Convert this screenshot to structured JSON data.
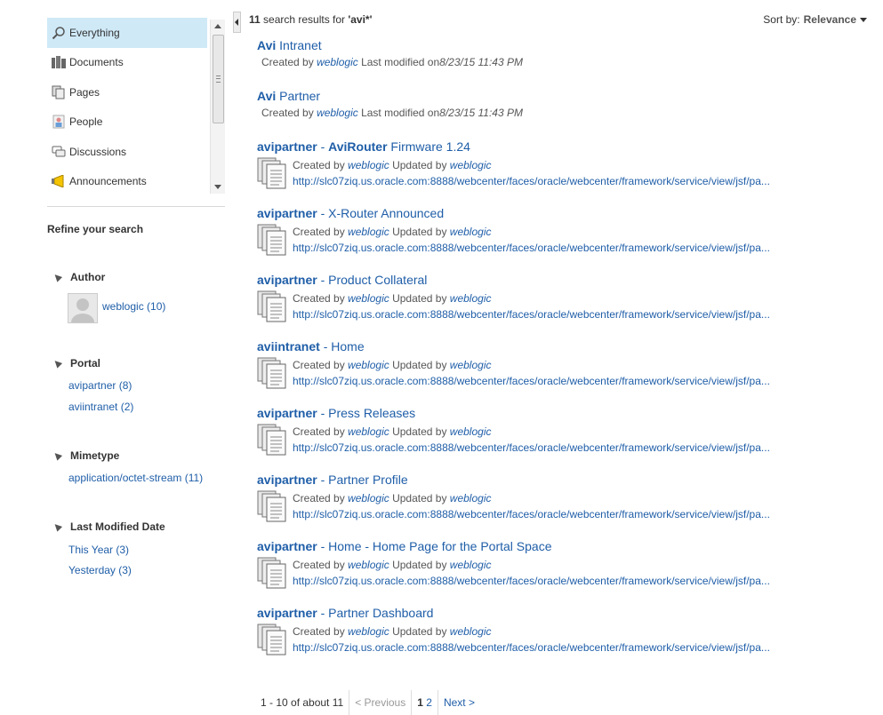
{
  "left": {
    "categories": [
      {
        "label": "Everything",
        "icon": "search-icon",
        "selected": true
      },
      {
        "label": "Documents",
        "icon": "documents-icon"
      },
      {
        "label": "Pages",
        "icon": "pages-icon"
      },
      {
        "label": "People",
        "icon": "people-icon"
      },
      {
        "label": "Discussions",
        "icon": "discussions-icon"
      },
      {
        "label": "Announcements",
        "icon": "announcements-icon"
      }
    ],
    "refine_label": "Refine your search",
    "facets": {
      "author": {
        "title": "Author",
        "items": [
          "weblogic (10)"
        ]
      },
      "portal": {
        "title": "Portal",
        "items": [
          "avipartner (8)",
          "aviintranet (2)"
        ]
      },
      "mimetype": {
        "title": "Mimetype",
        "items": [
          "application/octet-stream (11)"
        ]
      },
      "modified": {
        "title": "Last Modified Date",
        "items": [
          "This Year (3)",
          "Yesterday (3)"
        ]
      }
    }
  },
  "header": {
    "count": "11",
    "text": " search results for ",
    "query": "'avi*'",
    "sort_label": "Sort by:",
    "sort_value": "Relevance"
  },
  "results": [
    {
      "title_bold": "Avi",
      "title_rest": " Intranet",
      "type": "page",
      "created_label": "Created by ",
      "user": "weblogic",
      "mod_label": " Last modified on",
      "date": "8/23/15 11:43 PM"
    },
    {
      "title_bold": "Avi",
      "title_rest": " Partner",
      "type": "page",
      "created_label": "Created by ",
      "user": "weblogic",
      "mod_label": " Last modified on",
      "date": "8/23/15 11:43 PM"
    },
    {
      "title_bold": "avipartner",
      "title_mid": " - ",
      "title_bold2": "AviRouter",
      "title_rest": " Firmware 1.24",
      "type": "doc",
      "created_label": "Created by ",
      "user": "weblogic",
      "upd_label": " Updated by ",
      "user2": "weblogic",
      "url": "http://slc07ziq.us.oracle.com:8888/webcenter/faces/oracle/webcenter/framework/service/view/jsf/pa..."
    },
    {
      "title_bold": "avipartner",
      "title_rest": " - X-Router Announced",
      "type": "doc",
      "created_label": "Created by ",
      "user": "weblogic",
      "upd_label": " Updated by ",
      "user2": "weblogic",
      "url": "http://slc07ziq.us.oracle.com:8888/webcenter/faces/oracle/webcenter/framework/service/view/jsf/pa..."
    },
    {
      "title_bold": "avipartner",
      "title_rest": " - Product Collateral",
      "type": "doc",
      "created_label": "Created by ",
      "user": "weblogic",
      "upd_label": " Updated by ",
      "user2": "weblogic",
      "url": "http://slc07ziq.us.oracle.com:8888/webcenter/faces/oracle/webcenter/framework/service/view/jsf/pa..."
    },
    {
      "title_bold": "aviintranet",
      "title_rest": " - Home",
      "type": "doc",
      "created_label": "Created by ",
      "user": "weblogic",
      "upd_label": " Updated by ",
      "user2": "weblogic",
      "url": "http://slc07ziq.us.oracle.com:8888/webcenter/faces/oracle/webcenter/framework/service/view/jsf/pa..."
    },
    {
      "title_bold": "avipartner",
      "title_rest": " - Press Releases",
      "type": "doc",
      "created_label": "Created by ",
      "user": "weblogic",
      "upd_label": " Updated by ",
      "user2": "weblogic",
      "url": "http://slc07ziq.us.oracle.com:8888/webcenter/faces/oracle/webcenter/framework/service/view/jsf/pa..."
    },
    {
      "title_bold": "avipartner",
      "title_rest": " - Partner Profile",
      "type": "doc",
      "created_label": "Created by ",
      "user": "weblogic",
      "upd_label": " Updated by ",
      "user2": "weblogic",
      "url": "http://slc07ziq.us.oracle.com:8888/webcenter/faces/oracle/webcenter/framework/service/view/jsf/pa..."
    },
    {
      "title_bold": "avipartner",
      "title_rest": " - Home - Home Page for the Portal Space",
      "type": "doc",
      "created_label": "Created by ",
      "user": "weblogic",
      "upd_label": " Updated by ",
      "user2": "weblogic",
      "url": "http://slc07ziq.us.oracle.com:8888/webcenter/faces/oracle/webcenter/framework/service/view/jsf/pa..."
    },
    {
      "title_bold": "avipartner",
      "title_rest": " - Partner Dashboard",
      "type": "doc",
      "created_label": "Created by ",
      "user": "weblogic",
      "upd_label": " Updated by ",
      "user2": "weblogic",
      "url": "http://slc07ziq.us.oracle.com:8888/webcenter/faces/oracle/webcenter/framework/service/view/jsf/pa..."
    }
  ],
  "pager": {
    "range": "1 - 10 of about 11",
    "prev": "< Previous",
    "page1": "1",
    "page2": "2",
    "next": "Next >"
  }
}
